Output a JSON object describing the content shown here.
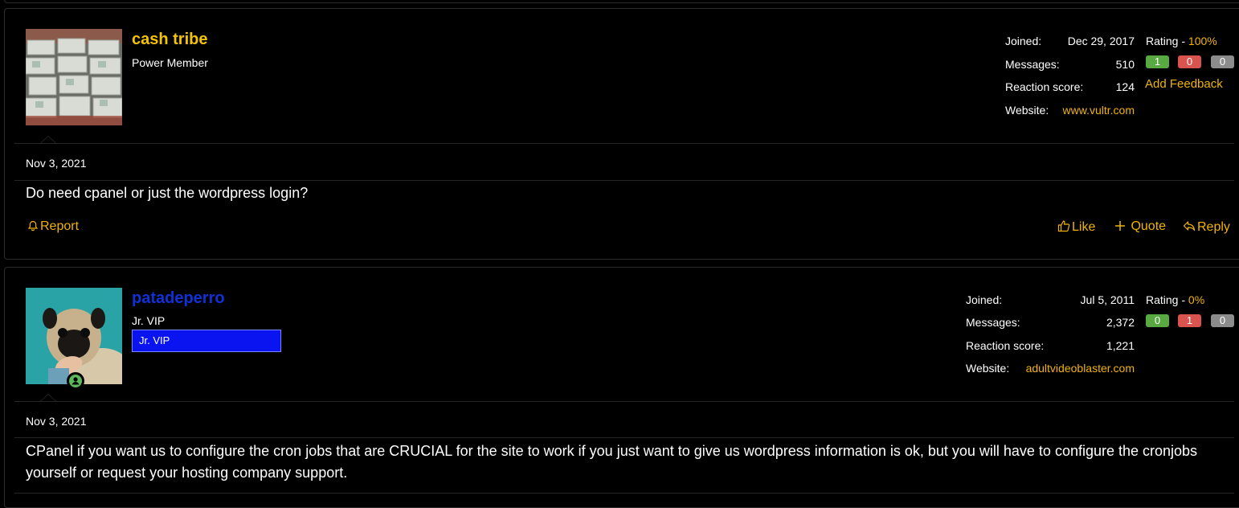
{
  "posts": [
    {
      "username": "cash tribe",
      "user_title": "Power Member",
      "username_color": "#f5c400",
      "joined_label": "Joined:",
      "joined": "Dec 29, 2017",
      "messages_label": "Messages:",
      "messages": "510",
      "reaction_label": "Reaction score:",
      "reaction": "124",
      "website_label": "Website:",
      "website": "www.vultr.com",
      "rating_label": "Rating - ",
      "rating": "100%",
      "pos": "1",
      "neg": "0",
      "neutral": "0",
      "add_feedback": "Add Feedback",
      "date": "Nov 3, 2021",
      "body": "Do need cpanel or just the wordpress login?",
      "report": "Report",
      "like": "Like",
      "quote": "Quote",
      "reply": "Reply"
    },
    {
      "username": "patadeperro",
      "user_title": "Jr. VIP",
      "banner": "Jr. VIP",
      "username_color": "#1030d8",
      "joined_label": "Joined:",
      "joined": "Jul 5, 2011",
      "messages_label": "Messages:",
      "messages": "2,372",
      "reaction_label": "Reaction score:",
      "reaction": "1,221",
      "website_label": "Website:",
      "website": "adultvideoblaster.com",
      "rating_label": "Rating - ",
      "rating": "0%",
      "pos": "0",
      "neg": "1",
      "neutral": "0",
      "date": "Nov 3, 2021",
      "body": "CPanel if you want us to configure the cron jobs that are CRUCIAL for the site to work if you just want to give us wordpress information is ok, but you will have to configure the cronjobs yourself or request your hosting company support."
    }
  ]
}
